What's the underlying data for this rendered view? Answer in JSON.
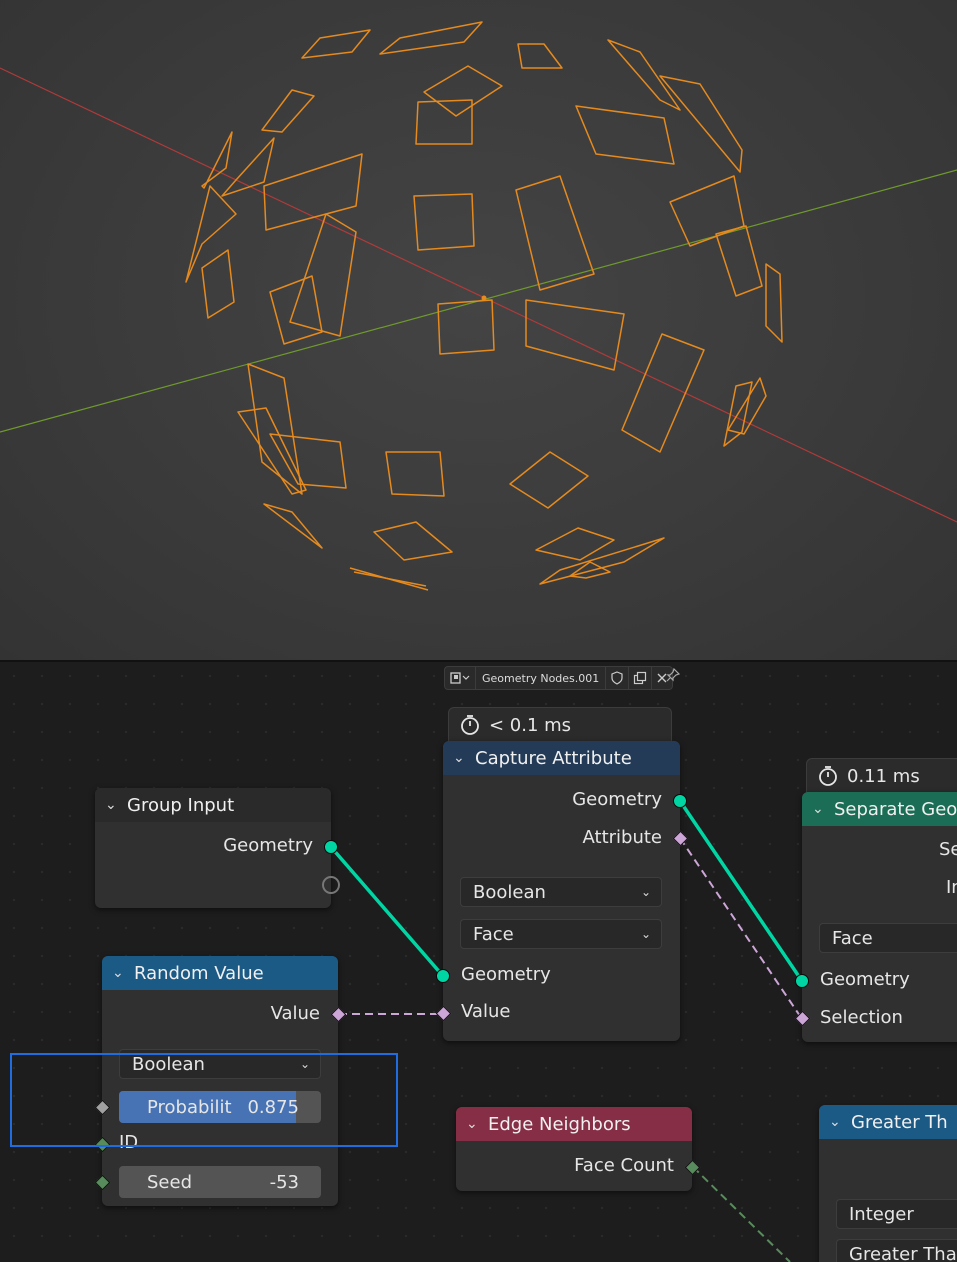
{
  "colors": {
    "wireframe": "#e58a1e",
    "x_axis": "#b03a3a",
    "y_axis": "#6f9a2d",
    "geometry_socket": "#00d6a3",
    "boolean_socket": "#cca6d6",
    "integer_socket": "#598c5c",
    "selection_outline": "#1f6de0",
    "header_utility": "#243b58",
    "header_function": "#1c5a86",
    "header_geometry": "#1b6d55",
    "header_input": "#862e45",
    "probability_fill": "#4772b3"
  },
  "editor_header": {
    "node_group_name": "Geometry Nodes.001",
    "icons": [
      "node-tree-icon",
      "fake-user-shield-icon",
      "duplicate-icon",
      "close-icon",
      "pin-icon"
    ]
  },
  "nodes": {
    "capture_attribute": {
      "timing": "< 0.1 ms",
      "title": "Capture Attribute",
      "outputs": [
        "Geometry",
        "Attribute"
      ],
      "data_type": "Boolean",
      "domain": "Face",
      "inputs": [
        "Geometry",
        "Value"
      ]
    },
    "group_input": {
      "title": "Group Input",
      "outputs": [
        "Geometry"
      ]
    },
    "random_value": {
      "title": "Random Value",
      "output": "Value",
      "data_type": "Boolean",
      "probability_label": "Probabilit",
      "probability_value": "0.875",
      "probability_fraction": 0.875,
      "id_label": "ID",
      "seed_label": "Seed",
      "seed_value": "-53"
    },
    "separate_geometry": {
      "timing": "0.11 ms",
      "title": "Separate Geo",
      "outputs_partial": [
        "Se",
        "In"
      ],
      "domain": "Face",
      "inputs": [
        "Geometry",
        "Selection"
      ]
    },
    "edge_neighbors": {
      "title": "Edge Neighbors",
      "output": "Face Count"
    },
    "greater_than": {
      "title": "Greater Th",
      "data_type": "Integer",
      "operation": "Greater Tha"
    }
  }
}
